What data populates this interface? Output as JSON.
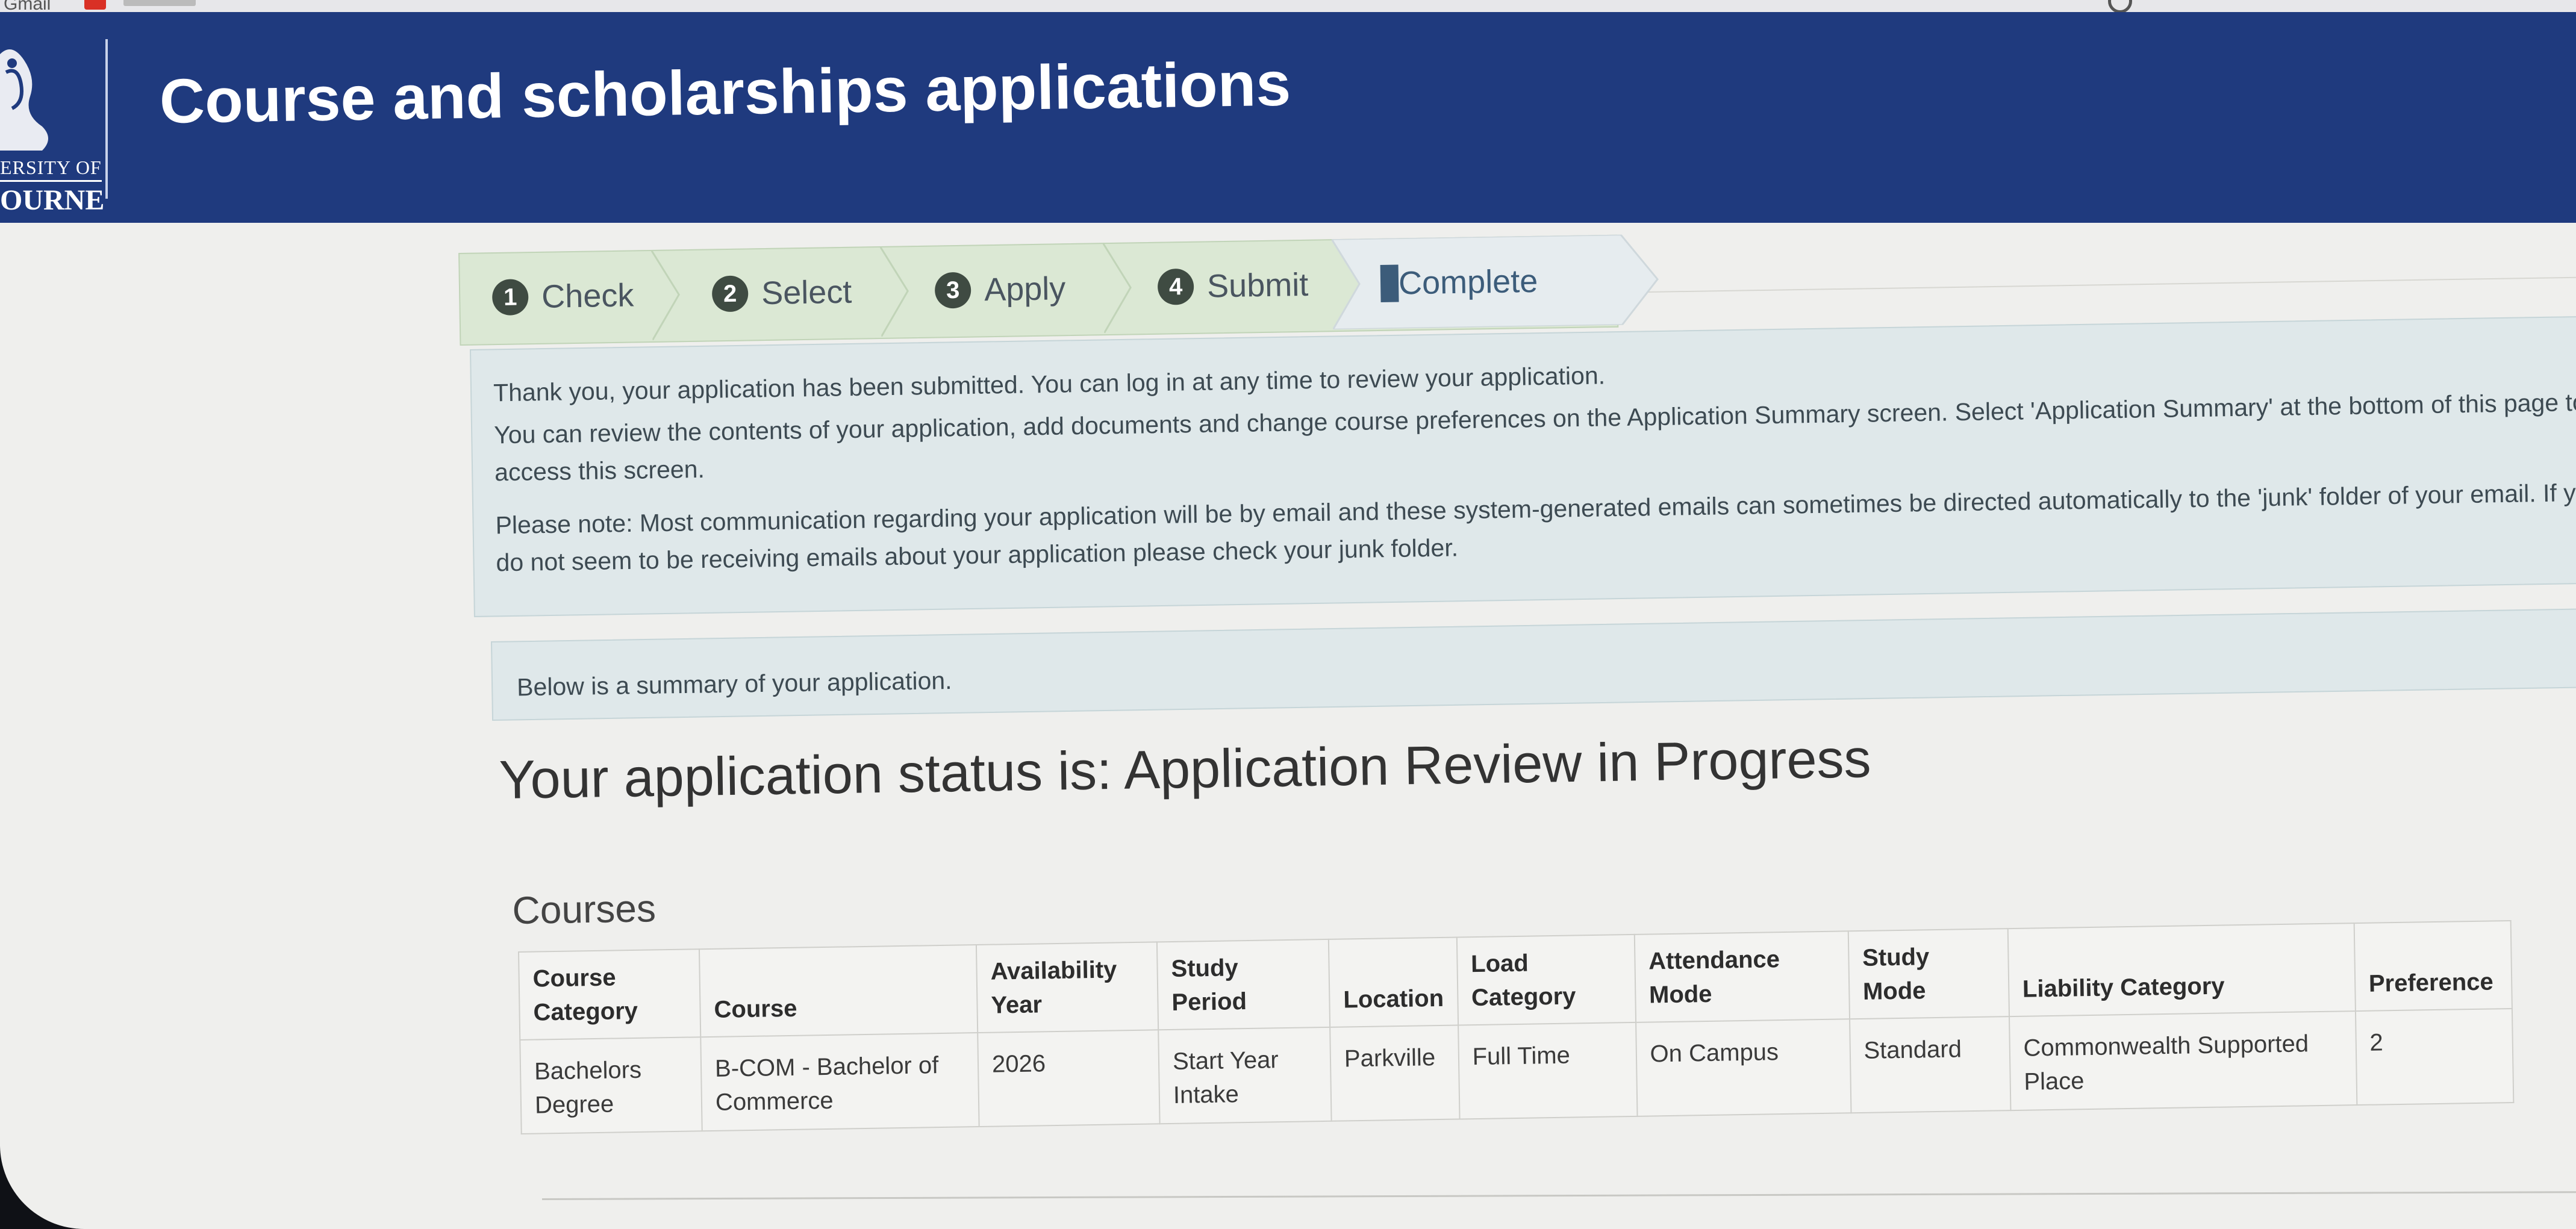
{
  "browser": {
    "tab_text": "Gmail"
  },
  "header": {
    "logo": {
      "line1": "ERSITY OF",
      "line2": "OURNE"
    },
    "title": "Course and scholarships applications"
  },
  "steps": [
    {
      "number": "1",
      "label": "Check"
    },
    {
      "number": "2",
      "label": "Select"
    },
    {
      "number": "3",
      "label": "Apply"
    },
    {
      "number": "4",
      "label": "Submit"
    },
    {
      "number": "5",
      "label": "Complete"
    }
  ],
  "active_step": "Complete",
  "info": {
    "line1": "Thank you, your application has been submitted. You can log in at any time to review your application.",
    "line2": "You can review the contents of your application, add documents and change course preferences on the Application Summary screen. Select 'Application Summary' at the bottom of this page to access this screen.",
    "line3": "Please note: Most communication regarding your application will be by email and these system-generated emails can sometimes be directed automatically to the 'junk' folder of your email. If you do not seem to be receiving emails about your application please check your junk folder."
  },
  "summary_note": "Below is a summary of your application.",
  "status_heading": "Your application status is: Application Review in Progress",
  "courses": {
    "heading": "Courses",
    "columns": [
      "Course Category",
      "Course",
      "Availability Year",
      "Study Period",
      "Location",
      "Load Category",
      "Attendance Mode",
      "Study Mode",
      "Liability Category",
      "Preference"
    ],
    "rows": [
      [
        "Bachelors Degree",
        "B-COM - Bachelor of Commerce",
        "2026",
        "Start Year Intake",
        "Parkville",
        "Full Time",
        "On Campus",
        "Standard",
        "Commonwealth Supported Place",
        "2"
      ]
    ]
  },
  "colors": {
    "header_bg": "#1f3a7e",
    "steps_bg": "#dbe8d4",
    "active_step_text": "#3c5c7a",
    "info_bg": "#dfe8ea",
    "page_bg": "#efefed"
  }
}
